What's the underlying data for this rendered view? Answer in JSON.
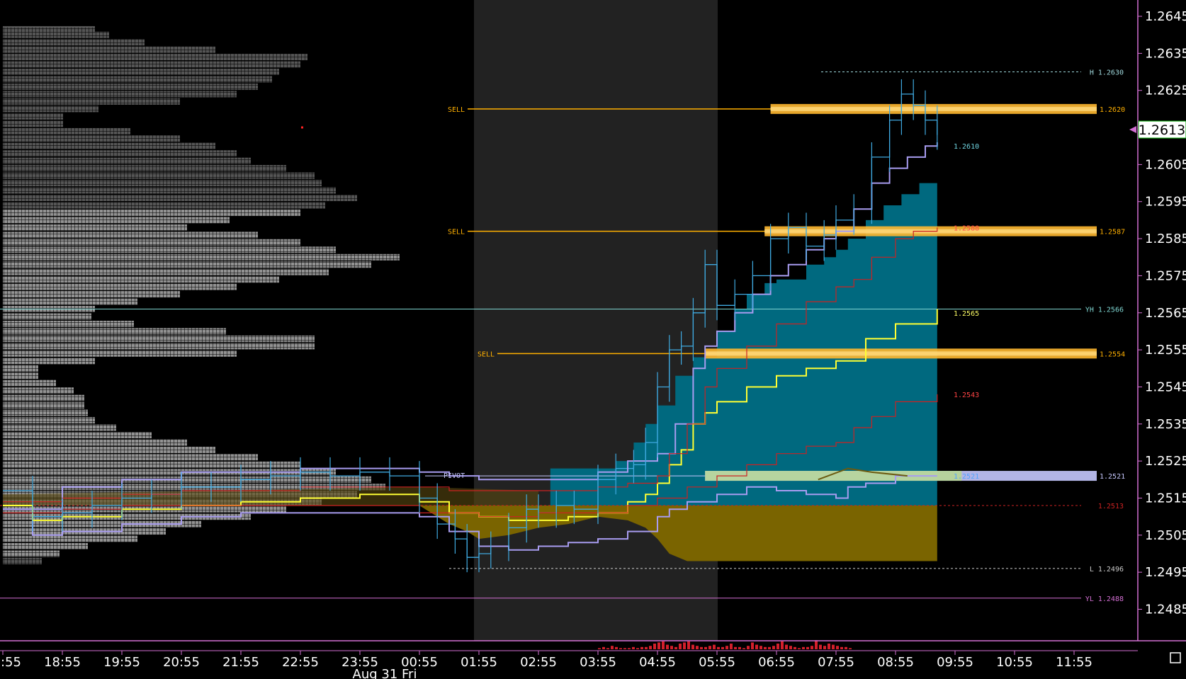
{
  "chart_data": {
    "type": "line",
    "y_range": [
      1.24765,
      1.26494
    ],
    "y_ticks": [
      "1.2645",
      "1.2635",
      "1.2625",
      "1.2615",
      "1.2605",
      "1.2595",
      "1.2585",
      "1.2575",
      "1.2565",
      "1.2555",
      "1.2545",
      "1.2535",
      "1.2525",
      "1.2515",
      "1.2505",
      "1.2495",
      "1.2485"
    ],
    "x_ticks": [
      "17:55",
      "18:55",
      "19:55",
      "20:55",
      "21:55",
      "22:55",
      "23:55",
      "00:55",
      "01:55",
      "02:55",
      "03:55",
      "04:55",
      "05:55",
      "06:55",
      "07:55",
      "08:55",
      "09:55",
      "10:55",
      "11:55"
    ],
    "date_label": "Aug 31 Fri",
    "current_price": "1.2613",
    "colors": {
      "background": "#000000",
      "session_band": "#222222",
      "profile_dark": "#5a5a5a",
      "profile_light": "#9a9a9a",
      "price": "#3fa9e0",
      "lavender": "#a89cf0",
      "yellow": "#ffff33",
      "red": "#cc2222",
      "teal_fill": "#00697f",
      "olive_fill": "#7a6400",
      "sell_line": "#ffb000",
      "axis": "#d36fd3"
    },
    "levels": [
      {
        "price": 1.263,
        "label": "H 1.2630",
        "color": "#9fd8dc",
        "style": "dashed"
      },
      {
        "price": 1.2566,
        "label": "YH 1.2566",
        "color": "#7fd6d2",
        "style": "solid"
      },
      {
        "price": 1.2513,
        "label": "1.2513",
        "color": "#cc2222",
        "style": "dashed"
      },
      {
        "price": 1.2496,
        "label": "L 1.2496",
        "color": "#cccccc",
        "style": "dashed"
      },
      {
        "price": 1.2488,
        "label": "YL 1.2488",
        "color": "#d36fd3",
        "style": "solid"
      }
    ],
    "sell_zones": [
      {
        "price": 1.262,
        "tag": "SELL",
        "label": "1.2620"
      },
      {
        "price": 1.2587,
        "tag": "SELL",
        "label": "1.2587"
      },
      {
        "price": 1.2554,
        "tag": "SELL",
        "label": "1.2554"
      }
    ],
    "pivot": {
      "price": 1.2521,
      "tag": "PIVOT",
      "label": "1.2521"
    },
    "inner_labels": [
      {
        "price": 1.261,
        "text": "1.2610",
        "color": "#6fd4e0"
      },
      {
        "price": 1.2588,
        "text": "1.2588",
        "color": "#ff4444"
      },
      {
        "price": 1.2565,
        "text": "1.2565",
        "color": "#ffff66"
      },
      {
        "price": 1.2543,
        "text": "1.2543",
        "color": "#ff4444"
      },
      {
        "price": 1.2521,
        "text": "1.2521",
        "color": "#4fa3ff"
      }
    ],
    "series": [
      {
        "name": "price",
        "color": "#3fa9e0",
        "x": [
          0,
          0.5,
          1,
          1.5,
          2,
          2.5,
          3,
          3.5,
          4,
          4.5,
          5,
          5.5,
          6,
          6.5,
          7,
          7.3,
          7.6,
          7.8,
          8,
          8.2,
          8.5,
          8.8,
          9,
          9.3,
          9.6,
          10,
          10.3,
          10.6,
          10.8,
          11,
          11.2,
          11.4,
          11.6,
          11.8,
          12,
          12.3,
          12.6,
          12.9,
          13.2,
          13.5,
          13.8,
          14,
          14.3,
          14.6,
          14.9,
          15.1,
          15.3,
          15.5,
          15.7
        ],
        "y": [
          1.2517,
          1.251,
          1.2511,
          1.2513,
          1.2515,
          1.2516,
          1.2518,
          1.2518,
          1.252,
          1.2521,
          1.2522,
          1.2521,
          1.2522,
          1.2521,
          1.2515,
          1.2508,
          1.2504,
          1.2499,
          1.25,
          1.2502,
          1.2507,
          1.2512,
          1.2511,
          1.2513,
          1.2512,
          1.252,
          1.2523,
          1.2524,
          1.253,
          1.2545,
          1.2555,
          1.2556,
          1.2565,
          1.2578,
          1.2567,
          1.257,
          1.2575,
          1.2585,
          1.2588,
          1.2583,
          1.2586,
          1.259,
          1.2593,
          1.2607,
          1.2617,
          1.2624,
          1.2621,
          1.2617,
          1.2613
        ]
      },
      {
        "name": "upper",
        "color": "#a89cf0",
        "x": [
          0,
          1,
          2,
          3,
          4,
          5,
          6,
          7,
          7.5,
          8,
          9,
          10,
          10.5,
          11,
          11.3,
          11.6,
          11.8,
          12,
          12.3,
          12.6,
          12.9,
          13.2,
          13.5,
          13.8,
          14,
          14.3,
          14.6,
          14.9,
          15.2,
          15.5,
          15.7
        ],
        "y": [
          1.2512,
          1.2518,
          1.252,
          1.2522,
          1.2522,
          1.2523,
          1.2523,
          1.2522,
          1.2521,
          1.252,
          1.252,
          1.2522,
          1.2525,
          1.2527,
          1.2535,
          1.255,
          1.2556,
          1.256,
          1.2565,
          1.257,
          1.2575,
          1.2578,
          1.2582,
          1.2585,
          1.2587,
          1.2593,
          1.26,
          1.2604,
          1.2607,
          1.261,
          1.2611
        ]
      },
      {
        "name": "lower",
        "color": "#a89cf0",
        "x": [
          0,
          0.5,
          1,
          2,
          3,
          4,
          5,
          6,
          7,
          7.5,
          8,
          8.5,
          9,
          9.5,
          10,
          10.5,
          10.8,
          11,
          11.2,
          11.5,
          12,
          12.5,
          13,
          13.5,
          14,
          14.2,
          14.5,
          15,
          15.7
        ],
        "y": [
          1.2512,
          1.2505,
          1.2506,
          1.2508,
          1.251,
          1.2511,
          1.2511,
          1.2511,
          1.251,
          1.2506,
          1.2502,
          1.2501,
          1.2502,
          1.2503,
          1.2504,
          1.2506,
          1.2506,
          1.251,
          1.2512,
          1.2514,
          1.2516,
          1.2518,
          1.2517,
          1.2516,
          1.2515,
          1.2518,
          1.2519,
          1.2521,
          1.2521
        ]
      },
      {
        "name": "yellow",
        "color": "#ffff33",
        "x": [
          0,
          0.5,
          1,
          2,
          3,
          4,
          5,
          6,
          7,
          7.5,
          8,
          8.5,
          9,
          9.5,
          10,
          10.5,
          10.8,
          11,
          11.2,
          11.4,
          11.6,
          11.8,
          12,
          12.5,
          13,
          13.5,
          14,
          14.5,
          15,
          15.7
        ],
        "y": [
          1.2513,
          1.2509,
          1.251,
          1.2512,
          1.2513,
          1.2514,
          1.2515,
          1.2516,
          1.2514,
          1.2511,
          1.251,
          1.2509,
          1.2509,
          1.251,
          1.2511,
          1.2514,
          1.2516,
          1.2519,
          1.2524,
          1.2528,
          1.2535,
          1.2538,
          1.2541,
          1.2545,
          1.2548,
          1.255,
          1.2552,
          1.2558,
          1.2562,
          1.2566
        ]
      },
      {
        "name": "red",
        "color": "#cc2222",
        "x": [
          0,
          1,
          2,
          3,
          4,
          5,
          6,
          7,
          7.5,
          8,
          9,
          10,
          10.5,
          11,
          11.2,
          11.5,
          11.8,
          12,
          12.5,
          13,
          13.5,
          14,
          14.3,
          14.6,
          15,
          15.3,
          15.7
        ],
        "y": [
          1.2514,
          1.2515,
          1.2516,
          1.2517,
          1.2517,
          1.2518,
          1.2518,
          1.2518,
          1.2517,
          1.2517,
          1.2517,
          1.2518,
          1.2519,
          1.2521,
          1.2527,
          1.2535,
          1.2545,
          1.255,
          1.2556,
          1.2562,
          1.2568,
          1.2572,
          1.2574,
          1.258,
          1.2585,
          1.2587,
          1.2588
        ]
      },
      {
        "name": "red-lower",
        "color": "#cc2222",
        "x": [
          0,
          1,
          2,
          3,
          4,
          5,
          6,
          7,
          8,
          9,
          10,
          10.5,
          11,
          11.5,
          12,
          12.5,
          13,
          13.5,
          14,
          14.3,
          14.6,
          15,
          15.7
        ],
        "y": [
          1.2511,
          1.2512,
          1.2513,
          1.2513,
          1.2513,
          1.2513,
          1.2513,
          1.2511,
          1.251,
          1.2511,
          1.2511,
          1.2513,
          1.2515,
          1.2518,
          1.2521,
          1.2524,
          1.2527,
          1.2529,
          1.253,
          1.2534,
          1.2537,
          1.2541,
          1.2543
        ]
      }
    ],
    "volume": [
      1,
      2,
      1,
      3,
      2,
      1,
      1,
      1,
      2,
      1,
      2,
      2,
      3,
      5,
      6,
      7,
      4,
      3,
      2,
      5,
      6,
      7,
      4,
      3,
      2,
      2,
      3,
      4,
      2,
      2,
      3,
      5,
      2,
      2,
      1,
      3,
      6,
      4,
      3,
      2,
      2,
      3,
      5,
      7,
      4,
      3,
      2,
      1,
      2,
      2,
      3,
      8,
      4,
      3,
      5,
      4,
      3,
      2,
      2,
      1
    ]
  }
}
